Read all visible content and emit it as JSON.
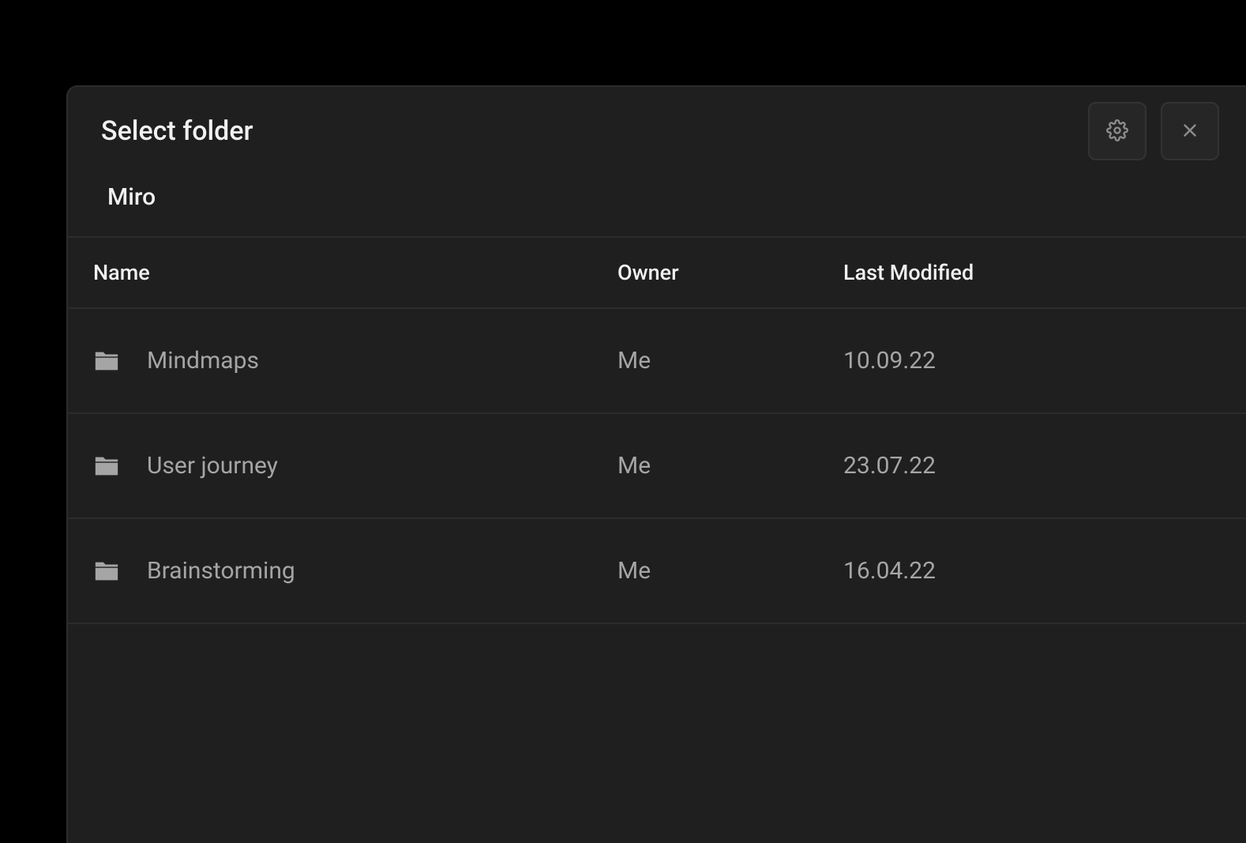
{
  "dialog": {
    "title": "Select folder",
    "breadcrumb": {
      "current": "Miro"
    }
  },
  "table": {
    "columns": {
      "name": "Name",
      "owner": "Owner",
      "modified": "Last Modified"
    },
    "rows": [
      {
        "name": "Mindmaps",
        "owner": "Me",
        "modified": "10.09.22"
      },
      {
        "name": "User journey",
        "owner": "Me",
        "modified": "23.07.22"
      },
      {
        "name": "Brainstorming",
        "owner": "Me",
        "modified": "16.04.22"
      }
    ]
  },
  "icons": {
    "settings": "gear-icon",
    "close": "close-icon",
    "folder": "folder-icon"
  }
}
